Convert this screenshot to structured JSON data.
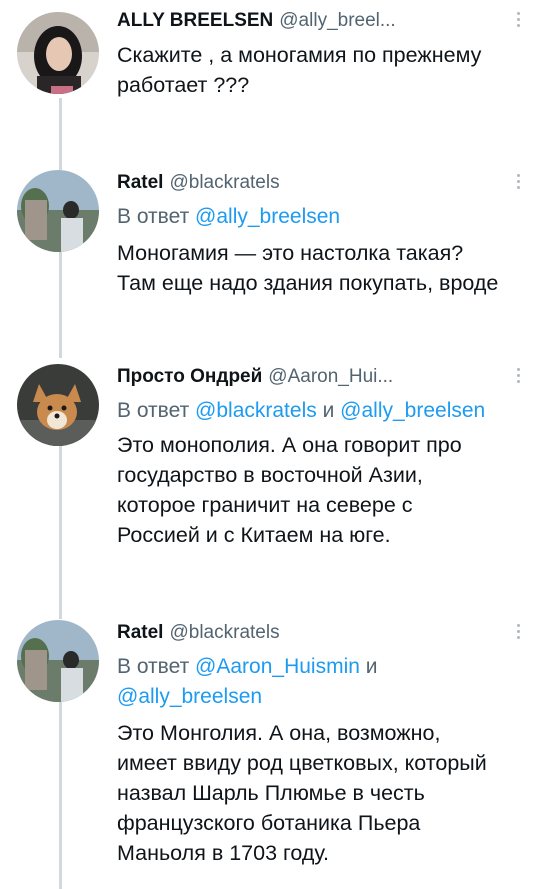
{
  "tweets": [
    {
      "name": "ALLY BREELSEN",
      "handle": "@ally_breel...",
      "text_lines": [
        "Скажите , а моногамия по прежнему",
        "работает ???"
      ]
    },
    {
      "name": "Ratel",
      "handle": "@blackratels",
      "reply_prefix": "В ответ",
      "reply_handles": [
        "@ally_breelsen"
      ],
      "text_lines": [
        "Моногамия — это настолка такая?",
        "Там еще надо здания покупать, вроде"
      ]
    },
    {
      "name": "Просто Ондрей",
      "handle": "@Aaron_Hui...",
      "reply_prefix": "В ответ",
      "reply_handles": [
        "@blackratels",
        "@ally_breelsen"
      ],
      "reply_joiner": "и",
      "text_lines": [
        "Это монополия. А она говорит про",
        "государство в восточной Азии,",
        "которое граничит на севере с",
        "Россией и с Китаем на юге."
      ]
    },
    {
      "name": "Ratel",
      "handle": "@blackratels",
      "reply_prefix": "В ответ",
      "reply_handles": [
        "@Aaron_Huismin",
        "@ally_breelsen"
      ],
      "reply_joiner": "и",
      "text_lines": [
        "Это Монголия. А она, возможно,",
        "имеет ввиду род цветковых, который",
        "назвал Шарль Плюмье в честь",
        "французского ботаника Пьера",
        "Маньоля в 1703 году."
      ]
    }
  ],
  "colors": {
    "link": "#1d9bf0",
    "secondary": "#536471",
    "thread_line": "#cfd9de"
  }
}
